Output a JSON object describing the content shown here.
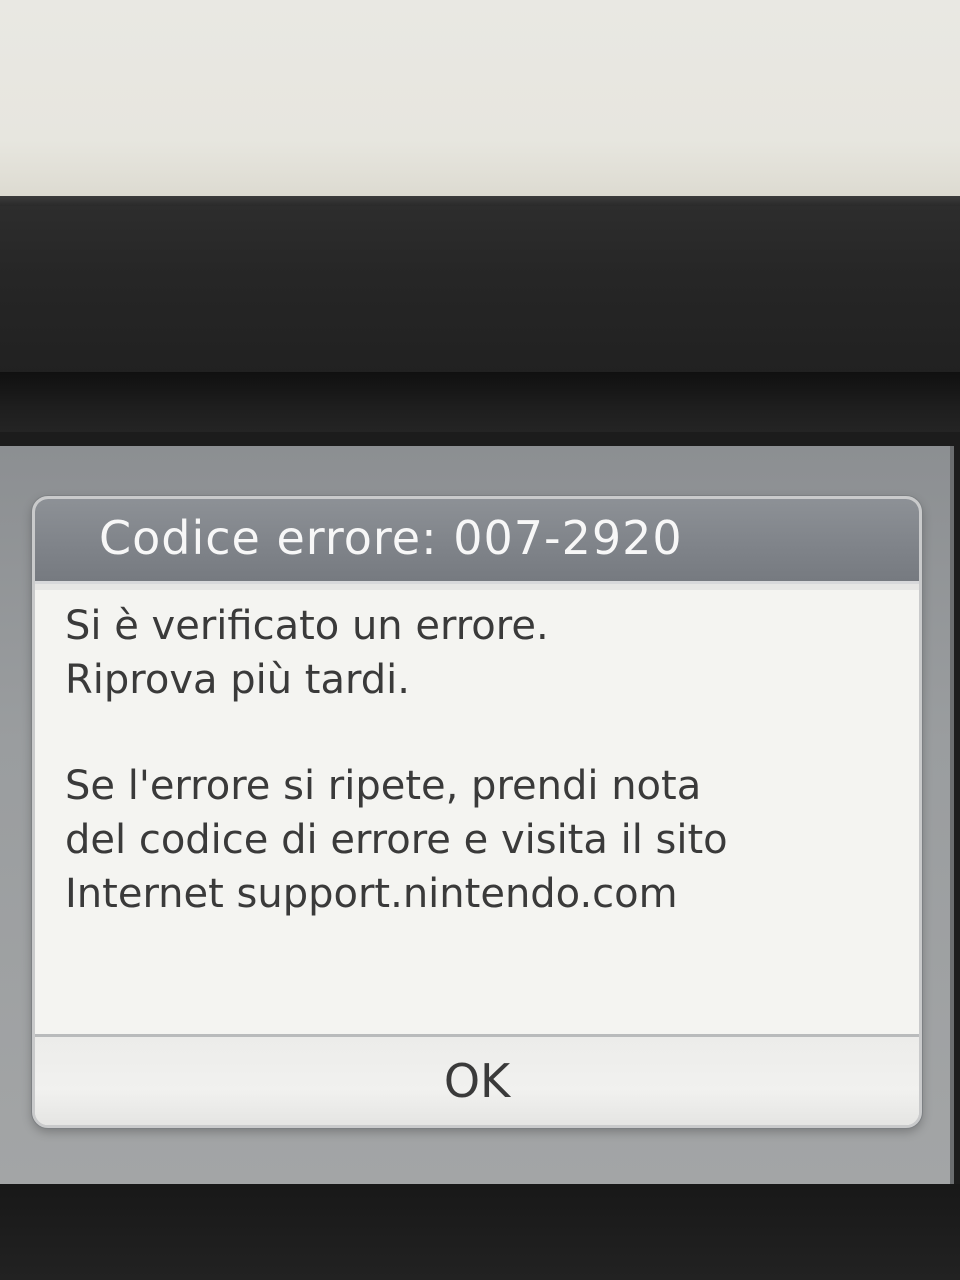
{
  "dialog": {
    "title": "Codice errore: 007-2920",
    "lines": [
      "Si è verificato un errore.",
      "Riprova più tardi.",
      "Se l'errore si ripete, prendi nota",
      "del codice di errore e visita il sito",
      "Internet support.nintendo.com"
    ],
    "ok_label": "OK"
  }
}
